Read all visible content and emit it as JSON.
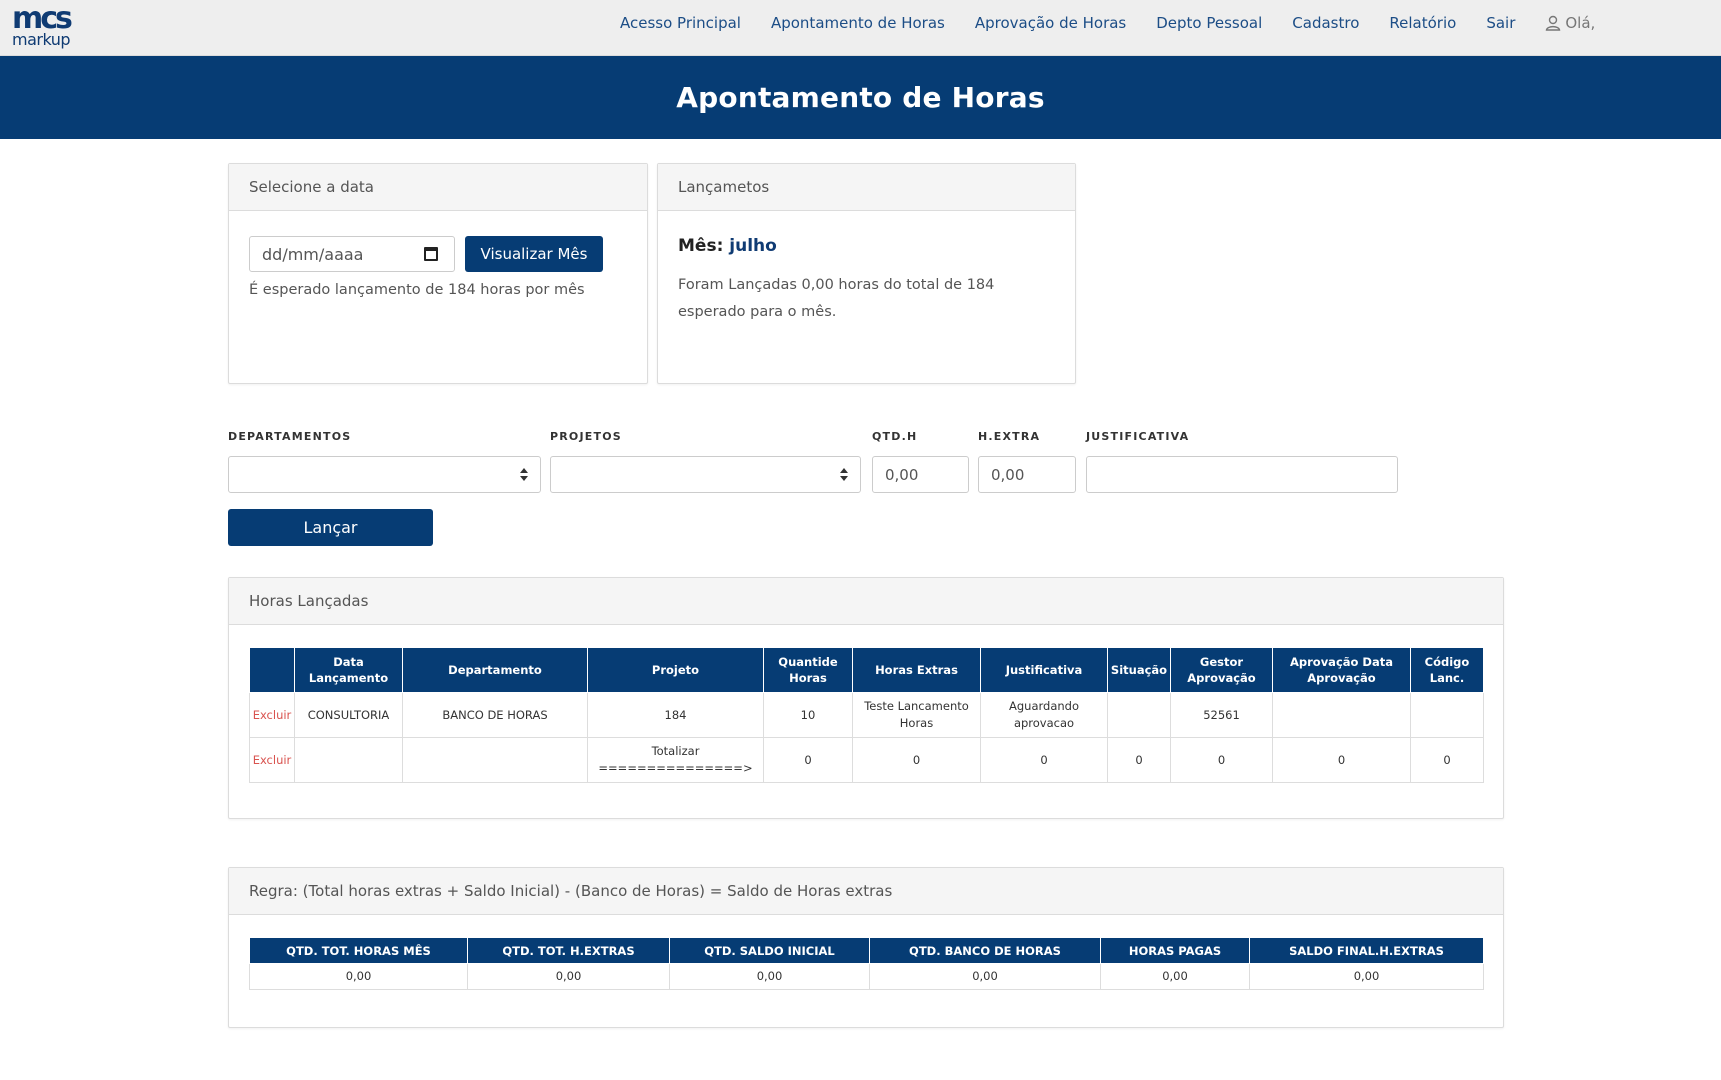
{
  "logo": {
    "top": "mcs",
    "bottom": "markup"
  },
  "nav": {
    "links": [
      "Acesso Principal",
      "Apontamento de Horas",
      "Aprovação de Horas",
      "Depto Pessoal",
      "Cadastro",
      "Relatório",
      "Sair"
    ],
    "user_greeting": "Olá,"
  },
  "header": {
    "title": "Apontamento de Horas"
  },
  "date_panel": {
    "title": "Selecione a data",
    "date_placeholder": "dd/mm/aaaa",
    "button_label": "Visualizar Mês",
    "hint": "É esperado lançamento de 184 horas por mês"
  },
  "lanc_panel": {
    "title": "Lançametos",
    "mes_label": "Mês:",
    "mes_value": "julho",
    "text": "Foram Lançadas 0,00 horas do total de 184 esperado para o mês."
  },
  "form": {
    "departamentos_label": "DEPARTAMENTOS",
    "projetos_label": "PROJETOS",
    "qtdh_label": "QTD.H",
    "qtdh_value": "0,00",
    "hextra_label": "H.EXTRA",
    "hextra_value": "0,00",
    "justificativa_label": "JUSTIFICATIVA",
    "submit_label": "Lançar"
  },
  "horas_panel": {
    "title": "Horas Lançadas",
    "columns": [
      "",
      "Data Lançamento",
      "Departamento",
      "Projeto",
      "Quantide Horas",
      "Horas Extras",
      "Justificativa",
      "Situação",
      "Gestor Aprovação",
      "Aprovação Data Aprovação",
      "Código Lanc."
    ],
    "rows": [
      [
        "Excluir",
        "CONSULTORIA",
        "BANCO DE HORAS",
        "184",
        "10",
        "Teste Lancamento Horas",
        "Aguardando aprovacao",
        "",
        "52561",
        "",
        ""
      ],
      [
        "Excluir",
        "",
        "",
        "Totalizar ===============>",
        "0",
        "0",
        "0",
        "0",
        "0",
        "0",
        "0"
      ]
    ]
  },
  "regra_panel": {
    "title": "Regra: (Total horas extras + Saldo Inicial) - (Banco de Horas) = Saldo de Horas extras",
    "columns": [
      "QTD. TOT. HORAS MÊS",
      "QTD. TOT. H.EXTRAS",
      "QTD. SALDO INICIAL",
      "QTD. BANCO DE HORAS",
      "HORAS PAGAS",
      "SALDO FINAL.H.EXTRAS"
    ],
    "values": [
      "0,00",
      "0,00",
      "0,00",
      "0,00",
      "0,00",
      "0,00"
    ]
  },
  "colors": {
    "brand": "#063c74",
    "link": "#1c4d86",
    "danger": "#d9534f"
  }
}
